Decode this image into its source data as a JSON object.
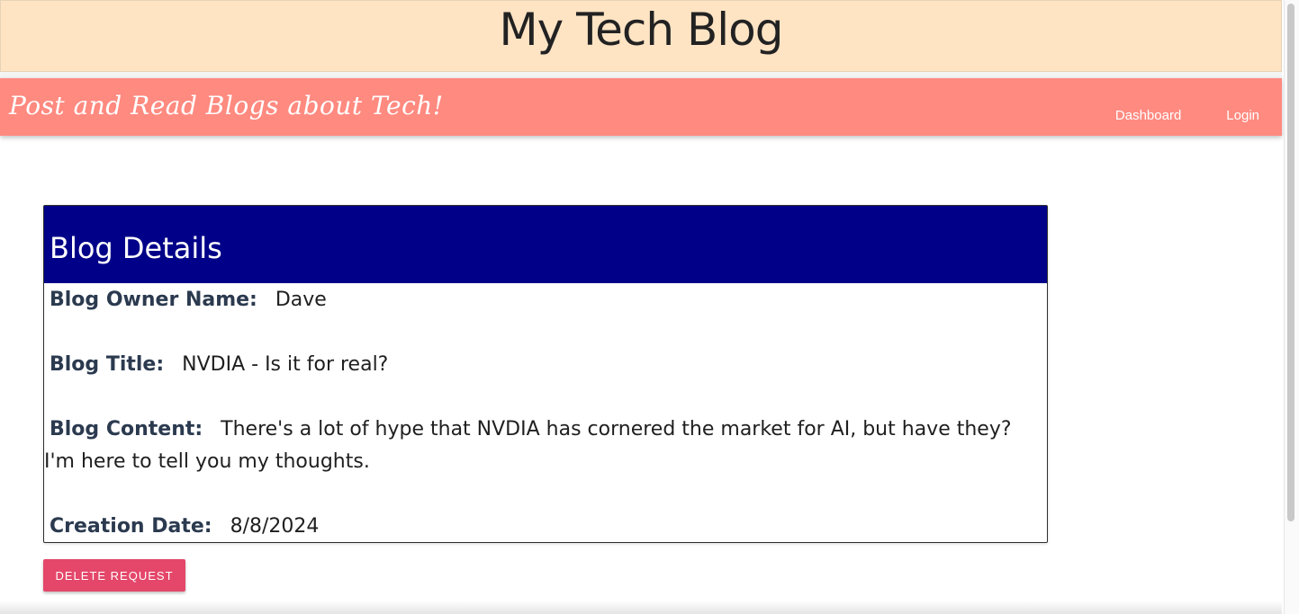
{
  "header": {
    "site_title": "My Tech Blog"
  },
  "navbar": {
    "tagline": "Post and Read Blogs about Tech!",
    "links": [
      {
        "label": "Dashboard"
      },
      {
        "label": "Login"
      }
    ],
    "background_color": "#ff8a80"
  },
  "card": {
    "title": "Blog Details",
    "header_color": "#000088",
    "owner_label": "Blog Owner Name:",
    "owner_value": "Dave",
    "title_label": "Blog Title:",
    "title_value": "NVDIA - Is it for real?",
    "content_label": "Blog Content:",
    "content_value": "There's a lot of hype that NVDIA has cornered the market for AI, but have they? I'm here to tell you my thoughts.",
    "date_label": "Creation Date:",
    "date_value": "8/8/2024"
  },
  "actions": {
    "delete_label": "DELETE REQUEST",
    "delete_color": "#e4476a"
  }
}
